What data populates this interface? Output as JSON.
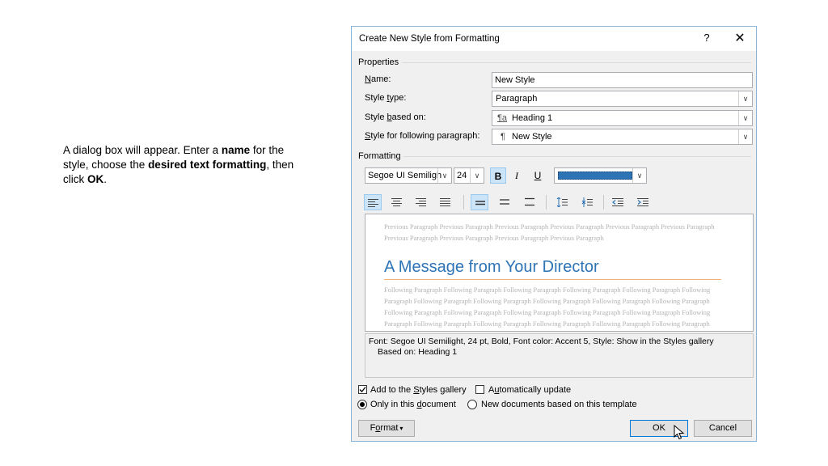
{
  "slide": {
    "instruction_part1": "A dialog box will appear. Enter a ",
    "instruction_name": "name",
    "instruction_part2": " for the style, choose the ",
    "instruction_desired": "desired text formatting",
    "instruction_part3": ", then click ",
    "instruction_ok": "OK",
    "instruction_end": "."
  },
  "dialog": {
    "title": "Create New Style from Formatting",
    "help_label": "?",
    "close_label": "✕",
    "properties": {
      "group_label": "Properties",
      "name_label_pre": "",
      "name_label_u": "N",
      "name_label_post": "ame:",
      "name_value": "New Style",
      "style_type_label_pre": "Style ",
      "style_type_label_u": "t",
      "style_type_label_post": "ype:",
      "style_type_value": "Paragraph",
      "based_on_label_pre": "Style ",
      "based_on_label_u": "b",
      "based_on_label_post": "ased on:",
      "based_on_icon": "¶a",
      "based_on_value": "Heading 1",
      "following_label_pre": "",
      "following_label_u": "S",
      "following_label_post": "tyle for following paragraph:",
      "following_icon": "¶",
      "following_value": "New Style"
    },
    "formatting": {
      "group_label": "Formatting",
      "font_value": "Segoe UI Semiligh",
      "size_value": "24",
      "bold_label": "B",
      "italic_label": "I",
      "underline_label": "U",
      "font_color": "#2e74b5"
    },
    "preview": {
      "previous_text": "Previous Paragraph Previous Paragraph Previous Paragraph Previous Paragraph Previous Paragraph Previous Paragraph Previous Paragraph Previous Paragraph Previous Paragraph Previous Paragraph",
      "heading": "A Message from Your Director",
      "following_text": "Following Paragraph Following Paragraph Following Paragraph Following Paragraph Following Paragraph Following Paragraph Following Paragraph Following Paragraph Following Paragraph Following Paragraph Following Paragraph Following Paragraph Following Paragraph Following Paragraph Following Paragraph Following Paragraph Following Paragraph Following Paragraph Following Paragraph Following Paragraph Following Paragraph Following Paragraph Following Paragraph Following Paragraph Following Paragraph"
    },
    "description": {
      "line1": "Font: Segoe UI Semilight, 24 pt, Bold, Font color: Accent 5, Style: Show in the Styles gallery",
      "line2": "Based on: Heading 1"
    },
    "options": {
      "add_gallery_pre": "Add to the ",
      "add_gallery_u": "S",
      "add_gallery_post": "tyles gallery",
      "add_gallery_checked": true,
      "auto_update_pre": "A",
      "auto_update_u": "u",
      "auto_update_post": "tomatically update",
      "auto_update_checked": false,
      "only_doc_pre": "Only in this ",
      "only_doc_u": "d",
      "only_doc_post": "ocument",
      "only_doc_selected": true,
      "new_docs_label": "New documents based on this template"
    },
    "buttons": {
      "format_pre": "F",
      "format_u": "o",
      "format_post": "rmat",
      "format_caret": "▾",
      "ok_label": "OK",
      "cancel_label": "Cancel"
    }
  }
}
